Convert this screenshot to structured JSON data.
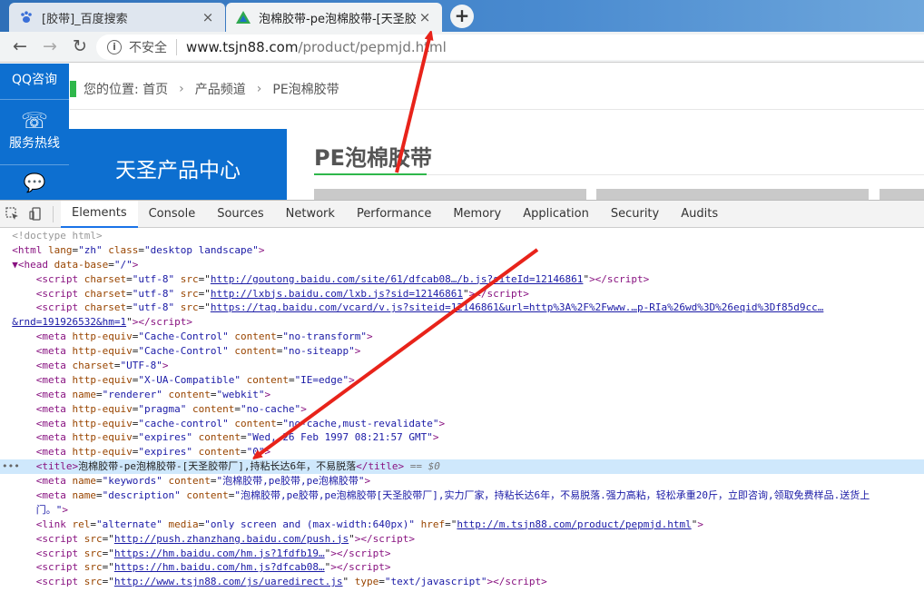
{
  "tabs": [
    {
      "title": "[胶带]_百度搜索",
      "close": "×"
    },
    {
      "title": "泡棉胶带-pe泡棉胶带-[天圣胶带",
      "close": "×"
    }
  ],
  "new_tab": "+",
  "address": {
    "back": "←",
    "forward": "→",
    "reload": "↻",
    "info": "i",
    "security": "不安全",
    "host": "www.tsjn88.com",
    "path": "/product/pepmjd.html"
  },
  "page": {
    "side": {
      "qq": "QQ咨询",
      "hotline": "服务热线",
      "msg_icon": "💬",
      "phone_icon": "☏"
    },
    "breadcrumb": {
      "prefix": "您的位置:",
      "items": [
        "首页",
        "产品频道",
        "PE泡棉胶带"
      ],
      "sep": "›"
    },
    "category_title": "天圣产品中心",
    "product_title": "PE泡棉胶带"
  },
  "devtools": {
    "tabs": [
      "Elements",
      "Console",
      "Sources",
      "Network",
      "Performance",
      "Memory",
      "Application",
      "Security",
      "Audits"
    ],
    "active_tab": "Elements",
    "dom": {
      "l1": "<!doctype html>",
      "l2_tag1": "<html ",
      "l2_attr1": "lang",
      "l2_val1": "\"zh\"",
      "l2_attr2": "class",
      "l2_val2": "\"desktop landscape\"",
      "l2_end": ">",
      "l3_tag": "▼<head ",
      "l3_attr": "data-base",
      "l3_val": "\"/\"",
      "l3_end": ">",
      "s1_src": "http://goutong.baidu.com/site/61/dfcab08…/b.js?siteId=12146861",
      "s2_src": "http://lxbjs.baidu.com/lxb.js?sid=12146861",
      "s3_src": "https://tag.baidu.com/vcard/v.js?siteid=12146861&url=http%3A%2F%2Fwww.…p-RIa%26wd%3D%26eqid%3Df85d9cc…",
      "s3_cont": "&rnd=191926532&hm=1",
      "m1": [
        "http-equiv",
        "\"Cache-Control\"",
        "content",
        "\"no-transform\""
      ],
      "m2": [
        "http-equiv",
        "\"Cache-Control\"",
        "content",
        "\"no-siteapp\""
      ],
      "m3": [
        "charset",
        "\"UTF-8\""
      ],
      "m4": [
        "http-equiv",
        "\"X-UA-Compatible\"",
        "content",
        "\"IE=edge\""
      ],
      "m5": [
        "name",
        "\"renderer\"",
        "content",
        "\"webkit\""
      ],
      "m6": [
        "http-equiv",
        "\"pragma\"",
        "content",
        "\"no-cache\""
      ],
      "m7": [
        "http-equiv",
        "\"cache-control\"",
        "content",
        "\"no-cache,must-revalidate\""
      ],
      "m8": [
        "http-equiv",
        "\"expires\"",
        "content",
        "\"Wed, 26 Feb 1997 08:21:57 GMT\""
      ],
      "m9": [
        "http-equiv",
        "\"expires\"",
        "content",
        "\"0\""
      ],
      "title_text": "泡棉胶带-pe泡棉胶带-[天圣胶带厂],持粘长达6年，不易脱落",
      "title_suffix": " == $0",
      "keywords": "\"泡棉胶带,pe胶带,pe泡棉胶带\"",
      "description": "\"泡棉胶带,pe胶带,pe泡棉胶带[天圣胶带厂],实力厂家，持粘长达6年，不易脱落.强力高粘，轻松承重20斤，立即咨询,领取免费样品.送货上",
      "description_cont": "门。\"",
      "alt_media": "\"only screen and (max-width:640px)\"",
      "alt_href": "http://m.tsjn88.com/product/pepmjd.html",
      "js1": "http://push.zhanzhang.baidu.com/push.js",
      "js2": "https://hm.baidu.com/hm.js?1fdfb19…",
      "js3": "https://hm.baidu.com/hm.js?dfcab08…",
      "js4": "http://www.tsjn88.com/js/uaredirect.js",
      "js4_type": "\"text/javascript\""
    }
  },
  "colors": {
    "accent_blue": "#0d6fd0",
    "accent_green": "#2fb74b",
    "arrow_red": "#e8231a"
  }
}
